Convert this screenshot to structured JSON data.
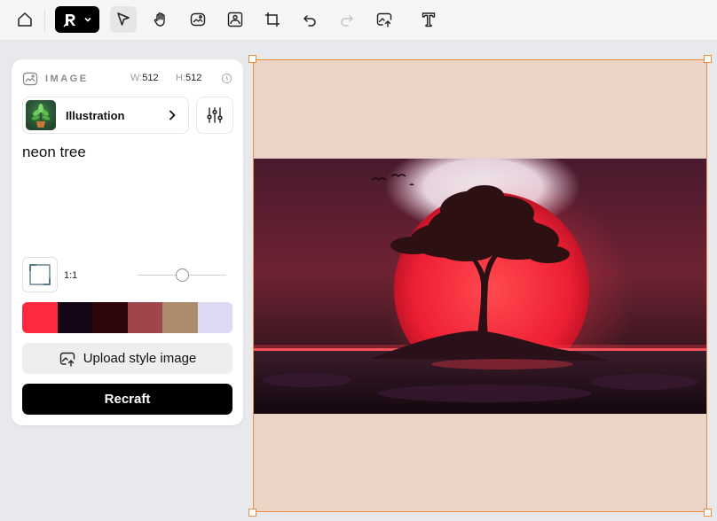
{
  "toolbar": {
    "tools": [
      {
        "name": "home",
        "icon": "home-icon"
      },
      {
        "name": "brand-menu",
        "icon": "recraft-logo-icon"
      },
      {
        "name": "select",
        "icon": "pointer-icon"
      },
      {
        "name": "hand",
        "icon": "hand-icon"
      },
      {
        "name": "image-edit",
        "icon": "image-icon"
      },
      {
        "name": "frame",
        "icon": "frame-icon"
      },
      {
        "name": "crop",
        "icon": "crop-icon"
      },
      {
        "name": "undo",
        "icon": "undo-icon"
      },
      {
        "name": "redo",
        "icon": "redo-icon"
      },
      {
        "name": "upload",
        "icon": "image-upload-icon"
      },
      {
        "name": "text",
        "icon": "text-icon"
      }
    ]
  },
  "panel": {
    "section_title": "IMAGE",
    "width_label": "W:",
    "width_value": "512",
    "height_label": "H:",
    "height_value": "512",
    "style_name": "Illustration",
    "prompt": "neon tree",
    "ratio_label": "1:1",
    "slider_fraction": 0.5,
    "palette": [
      "#ff2a3d",
      "#140616",
      "#2e0508",
      "#9f454c",
      "#ad8c6c",
      "#dcdaf5"
    ],
    "upload_label": "Upload style image",
    "recraft_label": "Recraft"
  },
  "canvas": {
    "frame_color": "#f08a3c",
    "background": "#ebd4c6"
  }
}
